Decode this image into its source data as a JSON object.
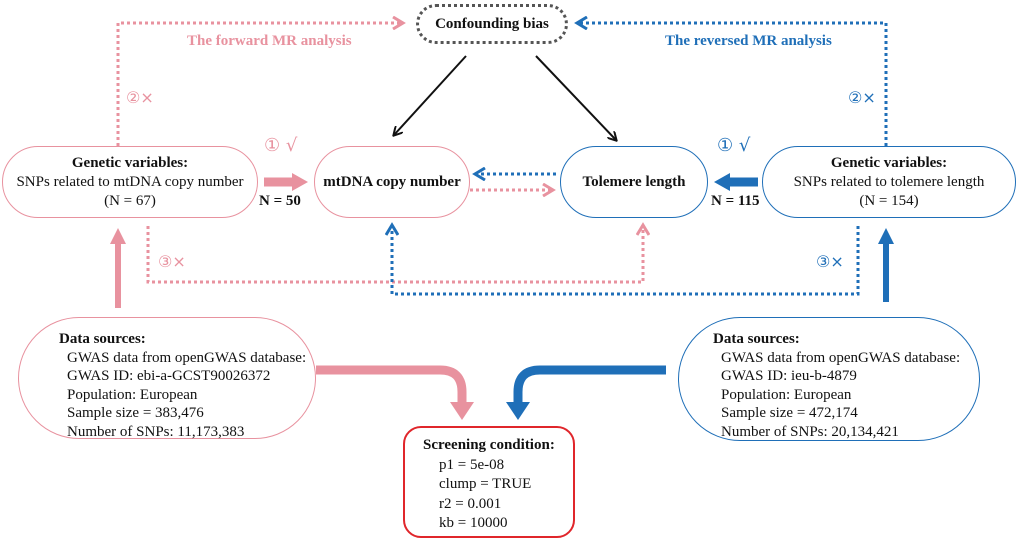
{
  "colors": {
    "forward": "#e8929f",
    "reversed": "#1f6fb8",
    "confounder": "#555555",
    "screening": "#e0262b",
    "arrow": "#111111"
  },
  "analyses": {
    "forward": "The forward MR analysis",
    "reversed": "The reversed MR analysis"
  },
  "confounder": {
    "label": "Confounding bias"
  },
  "exposure_mt": {
    "label": "mtDNA copy number"
  },
  "exposure_tl": {
    "label": "Tolemere length"
  },
  "genetic_mt": {
    "title": "Genetic variables:",
    "line1": "SNPs related to mtDNA copy number",
    "line2": "(N = 67)"
  },
  "genetic_tl": {
    "title": "Genetic variables:",
    "line1": "SNPs related to tolemere length",
    "line2": "(N = 154)"
  },
  "assumptions": {
    "fwd_1": "① √",
    "fwd_2": "②×",
    "fwd_3": "③×",
    "rev_1": "① √",
    "rev_2": "②×",
    "rev_3": "③×"
  },
  "counts": {
    "fwd_selected": "N = 50",
    "rev_selected": "N = 115"
  },
  "source_mt": {
    "title": "Data sources:",
    "lines": [
      "GWAS data from openGWAS database:",
      "GWAS ID: ebi-a-GCST90026372",
      "Population: European",
      "Sample size = 383,476",
      "Number of SNPs: 11,173,383"
    ]
  },
  "source_tl": {
    "title": "Data sources:",
    "lines": [
      "GWAS data from openGWAS database:",
      "GWAS ID: ieu-b-4879",
      "Population: European",
      "Sample size = 472,174",
      "Number of SNPs: 20,134,421"
    ]
  },
  "screening": {
    "title": "Screening condition:",
    "lines": [
      "p1 = 5e-08",
      "clump = TRUE",
      "r2 = 0.001",
      "kb = 10000"
    ]
  }
}
